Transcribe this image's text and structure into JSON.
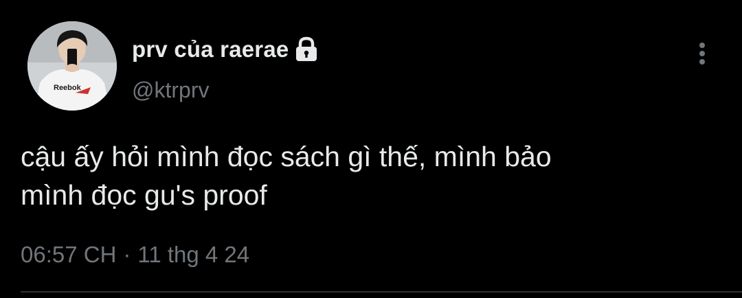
{
  "tweet": {
    "author": {
      "display_name": "prv của raerae",
      "handle": "@ktrprv",
      "protected_icon": "lock-icon",
      "avatar": "avatar-photo"
    },
    "text_line_1": "cậu ấy hỏi mình đọc sách gì thế, mình bảo",
    "text_line_2": "mình đọc gu's proof",
    "time": "06:57 CH",
    "separator": "·",
    "date": "11 thg 4 24",
    "more_icon": "more-vertical-icon"
  },
  "colors": {
    "background": "#000000",
    "primary_text": "#e7e9ea",
    "secondary_text": "#71767b",
    "divider": "#2f3336"
  }
}
